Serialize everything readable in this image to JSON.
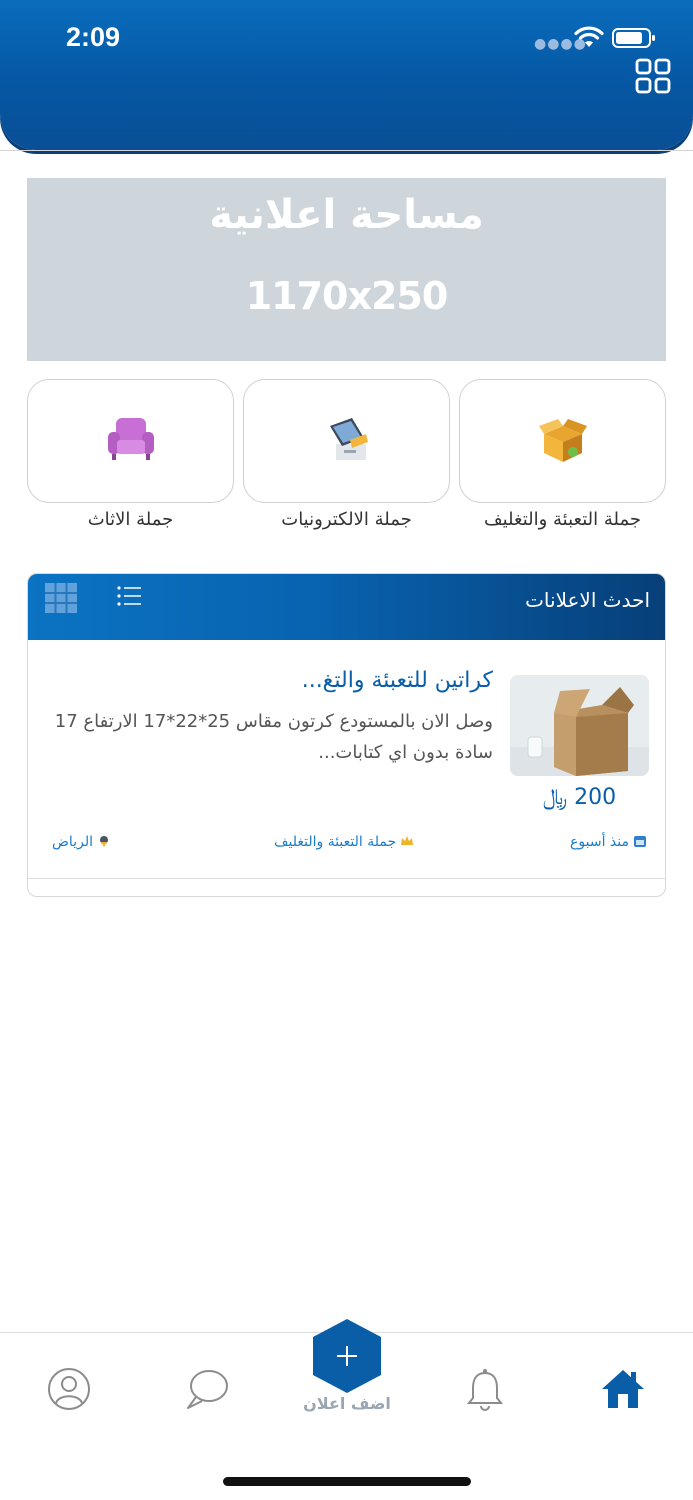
{
  "status_bar": {
    "time": "2:09",
    "signal_icon": "cellular-dots-icon",
    "wifi_icon": "wifi-icon",
    "battery_icon": "battery-icon"
  },
  "header": {
    "menu_icon": "grid-menu-icon",
    "gradient_colors": [
      "#0a6dbd",
      "#0557a3"
    ]
  },
  "ad_banner": {
    "title": "مساحة اعلانية",
    "size": "1170x250",
    "background": "#cfd6db"
  },
  "categories": [
    {
      "label": "جملة التعبئة والتغليف",
      "icon": "box-icon"
    },
    {
      "label": "جملة الالكترونيات",
      "icon": "electronics-icon"
    },
    {
      "label": "جملة الاثاث",
      "icon": "armchair-icon"
    }
  ],
  "latest": {
    "title": "احدث الاعلانات",
    "grid_view_icon": "grid-view-icon",
    "list_view_icon": "list-view-icon",
    "items": [
      {
        "title": "كراتين للتعبئة والتغ...",
        "description": "وصل الان بالمستودع كرتون مقاس 25*22*17 الارتفاع 17 سادة بدون اي كتابات...",
        "price": "200 ﷼",
        "time": "منذ أسبوع",
        "category": "جملة التعبئة والتغليف",
        "city": "الرياض",
        "thumb_icon": "cardboard-box-photo"
      }
    ]
  },
  "bottom_nav": {
    "home_icon": "home-icon",
    "notifications_icon": "bell-icon",
    "add_label": "اضف اعلان",
    "add_icon": "plus-hexagon-icon",
    "chat_icon": "chat-bubble-icon",
    "profile_icon": "user-icon",
    "accent": "#0a5ea8"
  }
}
